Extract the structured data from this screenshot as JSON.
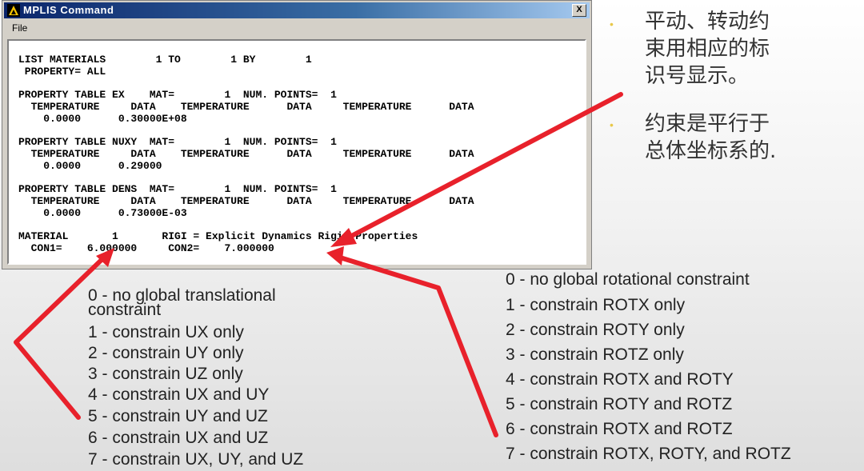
{
  "window": {
    "title": "MPLIS Command",
    "close_label": "X",
    "menu_file": "File"
  },
  "console_lines": [
    "LIST MATERIALS        1 TO        1 BY        1",
    " PROPERTY= ALL",
    "PROPERTY TABLE EX    MAT=        1  NUM. POINTS=  1",
    "  TEMPERATURE     DATA    TEMPERATURE      DATA     TEMPERATURE      DATA",
    "    0.0000      0.30000E+08",
    "PROPERTY TABLE NUXY  MAT=        1  NUM. POINTS=  1",
    "  TEMPERATURE     DATA    TEMPERATURE      DATA     TEMPERATURE      DATA",
    "    0.0000      0.29000",
    "PROPERTY TABLE DENS  MAT=        1  NUM. POINTS=  1",
    "  TEMPERATURE     DATA    TEMPERATURE      DATA     TEMPERATURE      DATA",
    "    0.0000      0.73000E-03",
    "MATERIAL       1       RIGI = Explicit Dynamics Rigid Properties",
    "  CON1=    6.000000     CON2=    7.000000"
  ],
  "notes": {
    "note1": [
      "平动、转动约",
      "束用相应的标",
      "识号显示。"
    ],
    "note2": [
      "约束是平行于",
      "总体坐标系的."
    ]
  },
  "con1_options": [
    "0 - no global translational",
    "constraint",
    "1 - constrain UX only",
    "2 - constrain UY only",
    "3 - constrain UZ only",
    "4 - constrain UX and UY",
    "5 - constrain UY and UZ",
    "6 - constrain UX and UZ",
    "7 - constrain UX, UY, and UZ"
  ],
  "con2_options": [
    "0 - no global rotational constraint",
    "1 - constrain ROTX only",
    "2 - constrain ROTY only",
    "3 - constrain ROTZ only",
    "4 - constrain ROTX and ROTY",
    "5 - constrain ROTY and ROTZ",
    "6 - constrain ROTX and ROTZ",
    "7 - constrain ROTX, ROTY, and ROTZ"
  ],
  "colors": {
    "arrow": "#e8212b",
    "title_bar": "#0a246a",
    "bullet": "#e8c84a"
  }
}
